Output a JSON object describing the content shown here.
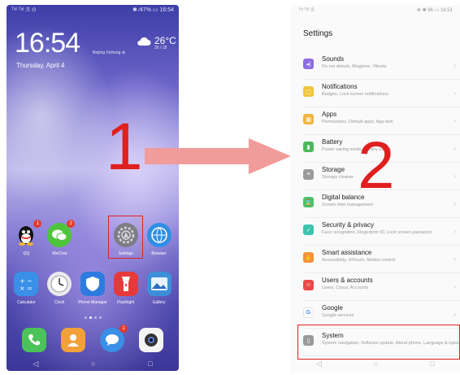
{
  "home": {
    "status_left": "ᵀᵃˡ ᵀᵃˡ ℛ ⊙",
    "status_right": "✱ ⁄47% ▭ 16:54",
    "time": "16:54",
    "date": "Thursday, April 4",
    "weather_city": "Beijing Xicheng ⊕",
    "temperature": "26°C",
    "temperature_sub": "26 / 18",
    "apps_row1": [
      {
        "label": "QQ",
        "badge": "1",
        "color": "#ffffff"
      },
      {
        "label": "WeChat",
        "badge": "2",
        "color": "#4ec43b"
      },
      {
        "label": "",
        "badge": "",
        "color": ""
      },
      {
        "label": "Settings",
        "badge": "",
        "color": "#7d7d85"
      },
      {
        "label": "Browser",
        "badge": "",
        "color": "#2f8fe6"
      }
    ],
    "apps_row2": [
      {
        "label": "Calculator",
        "color": "#3a8fe6"
      },
      {
        "label": "Clock",
        "color": "#e9e9ee"
      },
      {
        "label": "Phone Manager",
        "color": "#2e7be0"
      },
      {
        "label": "Flashlight",
        "color": "#e63a3a"
      },
      {
        "label": "Gallery",
        "color": "#3d8fd8"
      }
    ],
    "dock": [
      {
        "label": "Phone",
        "color": "#4cc35a"
      },
      {
        "label": "Contacts",
        "color": "#f2a13a"
      },
      {
        "label": "Messages",
        "badge": "1",
        "color": "#3a8fe6"
      },
      {
        "label": "Camera",
        "color": "#f4f4f4"
      }
    ],
    "nav": [
      "◁",
      "○",
      "□"
    ]
  },
  "annotations": {
    "step1": "1",
    "step2": "2",
    "arrow_color": "#f29b9b",
    "highlight_color": "#e02020"
  },
  "settings": {
    "status_left": "ᵀᵃˡ ᵀᵃˡ ℛ",
    "status_right": "⊗ ✱ 96 ▭ 16:51",
    "title": "Settings",
    "items": [
      {
        "title": "Sounds",
        "sub": "Do not disturb, Ringtone, Vibrate",
        "color": "#8c6ce0",
        "icon": "sound-icon",
        "glyph": "◂)"
      },
      {
        "title": "Notifications",
        "sub": "Badges, Lock screen notifications",
        "color": "#f0c43a",
        "icon": "notification-icon",
        "glyph": "▢"
      },
      {
        "title": "Apps",
        "sub": "Permissions, Default apps, App twin",
        "color": "#f0b440",
        "icon": "apps-icon",
        "glyph": "▦"
      },
      {
        "title": "Battery",
        "sub": "Power saving mode, Battery usage",
        "color": "#4bb85a",
        "icon": "battery-icon",
        "glyph": "▮"
      },
      {
        "title": "Storage",
        "sub": "Storage cleaner",
        "color": "#9a9a9a",
        "icon": "storage-icon",
        "glyph": "≡"
      },
      {
        "title": "Digital balance",
        "sub": "Screen time management",
        "color": "#4cc36a",
        "icon": "digital-balance-icon",
        "glyph": "⌛"
      },
      {
        "title": "Security & privacy",
        "sub": "Face recognition, Fingerprint ID, Lock screen password",
        "color": "#3cc3b0",
        "icon": "shield-icon",
        "glyph": "✓"
      },
      {
        "title": "Smart assistance",
        "sub": "Accessibility, HiTouch, Motion control",
        "color": "#f2923a",
        "icon": "hand-icon",
        "glyph": "✋"
      },
      {
        "title": "Users & accounts",
        "sub": "Users, Cloud, Accounts",
        "color": "#e84848",
        "icon": "user-icon",
        "glyph": "☺"
      },
      {
        "title": "Google",
        "sub": "Google services",
        "color": "#ffffff",
        "icon": "google-icon",
        "glyph": "G"
      },
      {
        "title": "System",
        "sub": "System navigation, Software update, About phone, Language & input",
        "color": "#9a9a9a",
        "icon": "system-icon",
        "glyph": "▯"
      }
    ],
    "nav": [
      "◁",
      "○",
      "□"
    ]
  }
}
